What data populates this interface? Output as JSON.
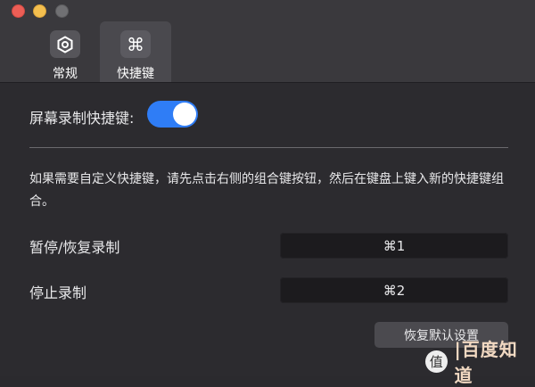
{
  "tabs": [
    {
      "label": "常规",
      "icon": "hexagon-gear-icon",
      "glyph": "⬡"
    },
    {
      "label": "快捷键",
      "icon": "command-icon",
      "glyph": "⌘"
    }
  ],
  "screen_record_shortcut": {
    "label": "屏幕录制快捷键:",
    "enabled": true
  },
  "description": "如果需要自定义快捷键，请先点击右侧的组合键按钮，然后在键盘上键入新的快捷键组合。",
  "shortcuts": [
    {
      "label": "暂停/恢复录制",
      "keys": "⌘1"
    },
    {
      "label": "停止录制",
      "keys": "⌘2"
    }
  ],
  "reset_label": "恢复默认设置",
  "watermark": {
    "glyph": "值",
    "text": "|百度知道"
  },
  "colors": {
    "accent": "#2f7df6",
    "background": "#2b2a2e",
    "titlebar": "#3a393d"
  }
}
